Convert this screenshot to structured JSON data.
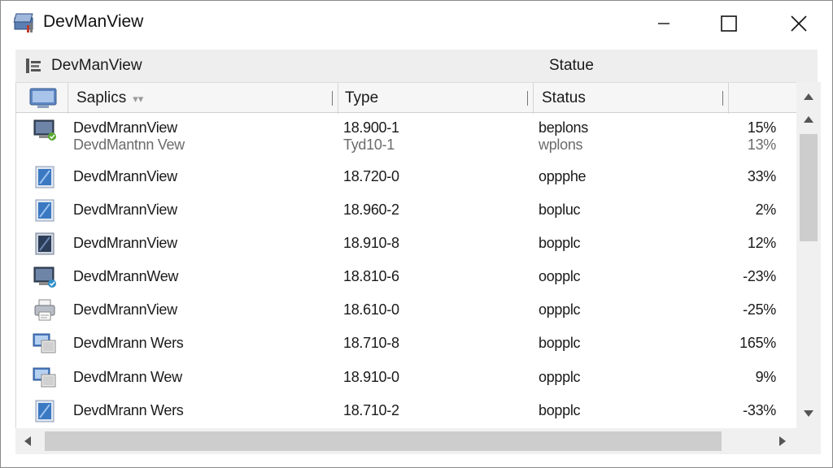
{
  "window": {
    "title": "DevManView",
    "icon": "devmanview-app-icon"
  },
  "subheader": {
    "title": "DevManView",
    "status_label": "Statue"
  },
  "columns": {
    "name": "Saplics",
    "type": "Type",
    "status": "Status"
  },
  "rows": [
    {
      "icon": "monitor-check-icon",
      "name": "DevdMrannView",
      "type": "18.900-1",
      "status": "beplons",
      "pct": "15%"
    },
    {
      "icon": "none",
      "name": "DevdMantnn Vew",
      "type": "Tyd10-1",
      "status": "wplons",
      "pct": "13%"
    },
    {
      "icon": "blue-tile-icon",
      "name": "DevdMrannView",
      "type": "18.720-0",
      "status": "oppphe",
      "pct": "33%"
    },
    {
      "icon": "blue-tile-icon",
      "name": "DevdMrannView",
      "type": "18.960-2",
      "status": "bopluc",
      "pct": "2%"
    },
    {
      "icon": "dark-tile-icon",
      "name": "DevdMrannView",
      "type": "18.910-8",
      "status": "bopplc",
      "pct": "12%"
    },
    {
      "icon": "monitor-check-icon",
      "name": "DevdMrannWew",
      "type": "18.810-6",
      "status": "oopplc",
      "pct": "-23%"
    },
    {
      "icon": "printer-icon",
      "name": "DevdMrannView",
      "type": "18.610-0",
      "status": "oppplc",
      "pct": "-25%"
    },
    {
      "icon": "monitors-icon",
      "name": "DevdMrann Wers",
      "type": "18.710-8",
      "status": "bopplc",
      "pct": "165%"
    },
    {
      "icon": "monitors-icon",
      "name": "DevdMrann Wew",
      "type": "18.910-0",
      "status": "oppplc",
      "pct": "9%"
    },
    {
      "icon": "blue-tile-icon",
      "name": "DevdMrann Wers",
      "type": "18.710-2",
      "status": "bopplc",
      "pct": "-33%"
    }
  ],
  "colors": {
    "accent_blue": "#2f6db8",
    "header_bg": "#f6f6f6",
    "scroll_thumb": "#cdcdcd"
  }
}
